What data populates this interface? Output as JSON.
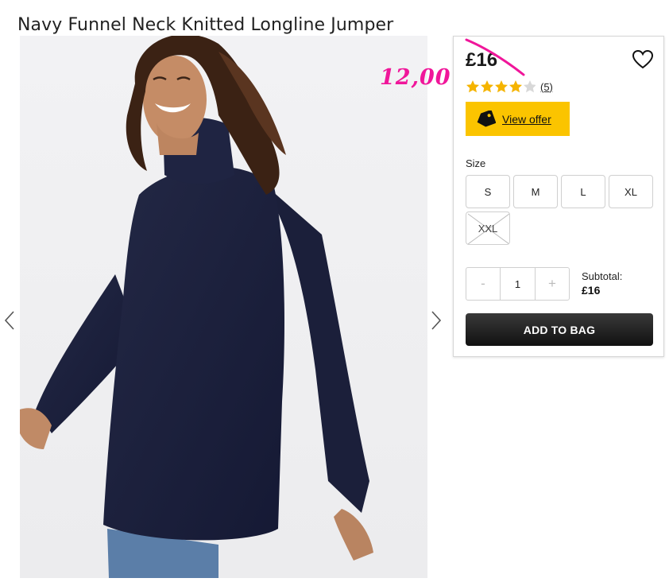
{
  "product": {
    "title": "Navy Funnel Neck Knitted Longline Jumper"
  },
  "price": {
    "current": "£16",
    "annotation": "12,00"
  },
  "rating": {
    "stars": 4.5,
    "max": 5,
    "count_label": "(5)"
  },
  "offer": {
    "label": "View offer"
  },
  "sizes": {
    "label": "Size",
    "options": [
      {
        "label": "S",
        "available": true
      },
      {
        "label": "M",
        "available": true
      },
      {
        "label": "L",
        "available": true
      },
      {
        "label": "XL",
        "available": true
      },
      {
        "label": "XXL",
        "available": false
      }
    ]
  },
  "quantity": {
    "minus": "-",
    "value": "1",
    "plus": "+"
  },
  "subtotal": {
    "label": "Subtotal:",
    "amount": "£16"
  },
  "cart": {
    "add_label": "ADD TO BAG"
  },
  "colors": {
    "offer_bg": "#fbc400",
    "star": "#f5b400",
    "annotation": "#f0169a",
    "button_dark": "#1a1a1a",
    "jumper": "#1c2140"
  },
  "icons": {
    "wishlist": "heart-icon",
    "offer": "price-tag-icon",
    "prev": "chevron-left-icon",
    "next": "chevron-right-icon"
  }
}
